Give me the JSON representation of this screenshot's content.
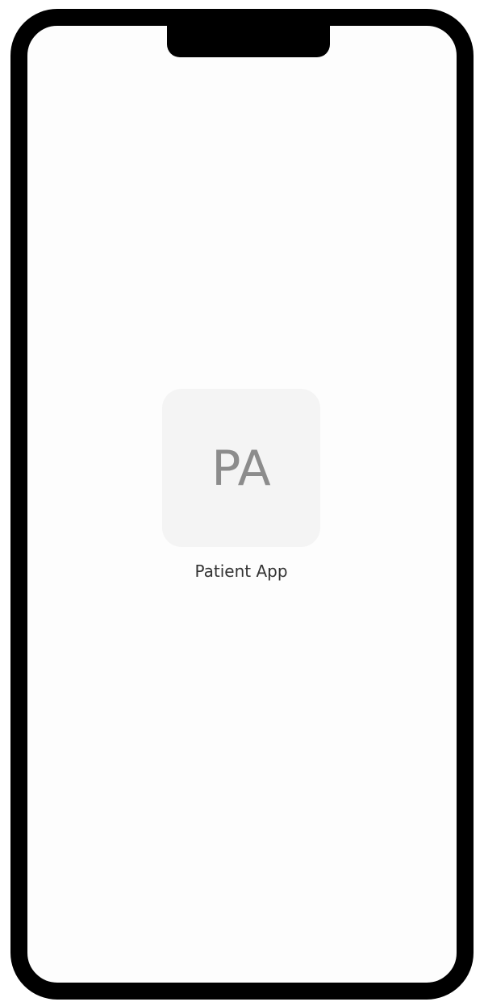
{
  "home_screen": {
    "app": {
      "icon_text": "PA",
      "label": "Patient App"
    }
  },
  "colors": {
    "frame": "#000000",
    "screen_background": "#fdfdfd",
    "icon_background": "#f4f4f4",
    "icon_text": "#8c8c8c",
    "label_text": "#333333"
  }
}
